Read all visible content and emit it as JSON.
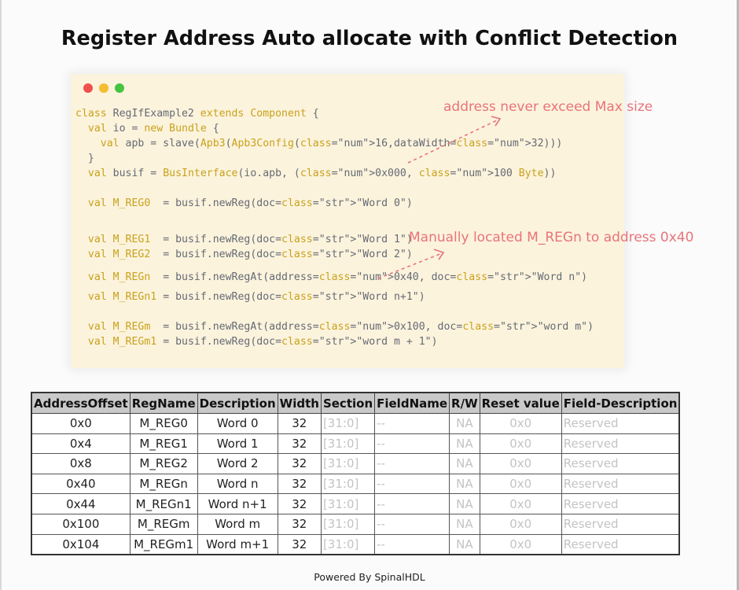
{
  "title": "Register Address Auto allocate with Conflict Detection",
  "code": {
    "lines": [
      "class RegIfExample2 extends Component {",
      "  val io = new Bundle {",
      "    val apb = slave(Apb3(Apb3Config(16,dataWidth=32)))",
      "  }",
      "  val busif = BusInterface(io.apb, (0x000, 100 Byte))",
      "  val M_REG0  = busif.newReg(doc=\"Word 0\")",
      "  val M_REG1  = busif.newReg(doc=\"Word 1\")",
      "  val M_REG2  = busif.newReg(doc=\"Word 2\")",
      "  val M_REGn  = busif.newRegAt(address=0x40, doc=\"Word n\")",
      "  val M_REGn1 = busif.newReg(doc=\"Word n+1\")",
      "  val M_REGm  = busif.newRegAt(address=0x100, doc=\"word m\")",
      "  val M_REGm1 = busif.newReg(doc=\"word m + 1\")"
    ]
  },
  "annotations": {
    "max_size": "address never exceed Max size",
    "manual": "Manually located M_REGn to address 0x40"
  },
  "table": {
    "headers": [
      "AddressOffset",
      "RegName",
      "Description",
      "Width",
      "Section",
      "FieldName",
      "R/W",
      "Reset value",
      "Field-Description"
    ],
    "rows": [
      [
        "0x0",
        "M_REG0",
        "Word 0",
        "32",
        "[31:0]",
        "--",
        "NA",
        "0x0",
        "Reserved"
      ],
      [
        "0x4",
        "M_REG1",
        "Word 1",
        "32",
        "[31:0]",
        "--",
        "NA",
        "0x0",
        "Reserved"
      ],
      [
        "0x8",
        "M_REG2",
        "Word 2",
        "32",
        "[31:0]",
        "--",
        "NA",
        "0x0",
        "Reserved"
      ],
      [
        "0x40",
        "M_REGn",
        "Word n",
        "32",
        "[31:0]",
        "--",
        "NA",
        "0x0",
        "Reserved"
      ],
      [
        "0x44",
        "M_REGn1",
        "Word n+1",
        "32",
        "[31:0]",
        "--",
        "NA",
        "0x0",
        "Reserved"
      ],
      [
        "0x100",
        "M_REGm",
        "Word m",
        "32",
        "[31:0]",
        "--",
        "NA",
        "0x0",
        "Reserved"
      ],
      [
        "0x104",
        "M_REGm1",
        "Word m+1",
        "32",
        "[31:0]",
        "--",
        "NA",
        "0x0",
        "Reserved"
      ]
    ]
  },
  "footer": "Powered By SpinalHDL",
  "colors": {
    "code_bg": "#fcf3dd",
    "keyword": "#c8a21b",
    "string": "#3aa59a",
    "annotation": "#e8747a",
    "header_bg": "#c9c9c9"
  }
}
